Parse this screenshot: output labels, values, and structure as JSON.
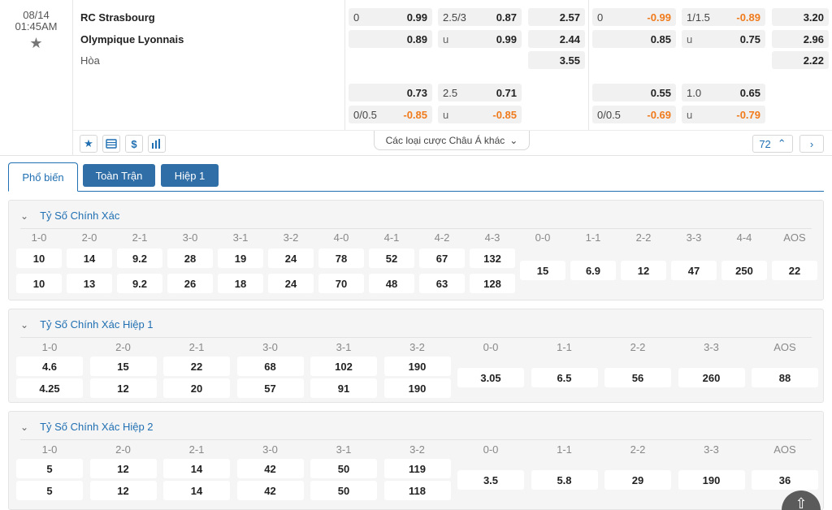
{
  "match": {
    "date": "08/14",
    "time": "01:45AM",
    "home": "RC Strasbourg",
    "away": "Olympique Lyonnais",
    "draw": "Hòa"
  },
  "odds": {
    "ft": {
      "row1": {
        "hcap": "0",
        "hcap_odd": "0.99",
        "ou": "2.5/3",
        "ou_odd": "0.87",
        "x12": "2.57"
      },
      "row2": {
        "hcap_odd": "0.89",
        "ou_lbl": "u",
        "ou_odd": "0.99",
        "x12": "2.44"
      },
      "row3": {
        "x12": "3.55"
      },
      "row4": {
        "hcap_odd": "0.73",
        "ou": "2.5",
        "ou_odd": "0.71"
      },
      "row5": {
        "hcap": "0/0.5",
        "hcap_odd": "-0.85",
        "ou_lbl": "u",
        "ou_odd": "-0.85"
      }
    },
    "h1": {
      "row1": {
        "hcap": "0",
        "hcap_odd": "-0.99",
        "ou": "1/1.5",
        "ou_odd": "-0.89",
        "x12": "3.20"
      },
      "row2": {
        "hcap_odd": "0.85",
        "ou_lbl": "u",
        "ou_odd": "0.75",
        "x12": "2.96"
      },
      "row3": {
        "x12": "2.22"
      },
      "row4": {
        "hcap_odd": "0.55",
        "ou": "1.0",
        "ou_odd": "0.65"
      },
      "row5": {
        "hcap": "0/0.5",
        "hcap_odd": "-0.69",
        "ou_lbl": "u",
        "ou_odd": "-0.79"
      }
    }
  },
  "toolbar": {
    "more_label": "Các loại cược Châu Á khác",
    "count": "72"
  },
  "tabs": [
    "Phổ biến",
    "Toàn Trận",
    "Hiệp 1"
  ],
  "sections": [
    {
      "title": "Tỷ Số Chính Xác",
      "labels": [
        "1-0",
        "2-0",
        "2-1",
        "3-0",
        "3-1",
        "3-2",
        "4-0",
        "4-1",
        "4-2",
        "4-3",
        "0-0",
        "1-1",
        "2-2",
        "3-3",
        "4-4",
        "AOS"
      ],
      "home": [
        "10",
        "14",
        "9.2",
        "28",
        "19",
        "24",
        "78",
        "52",
        "67",
        "132"
      ],
      "away": [
        "10",
        "13",
        "9.2",
        "26",
        "18",
        "24",
        "70",
        "48",
        "63",
        "128"
      ],
      "draws": [
        "15",
        "6.9",
        "12",
        "47",
        "250",
        "22"
      ]
    },
    {
      "title": "Tỷ Số Chính Xác Hiệp 1",
      "labels": [
        "1-0",
        "2-0",
        "2-1",
        "3-0",
        "3-1",
        "3-2",
        "0-0",
        "1-1",
        "2-2",
        "3-3",
        "AOS"
      ],
      "home": [
        "4.6",
        "15",
        "22",
        "68",
        "102",
        "190"
      ],
      "away": [
        "4.25",
        "12",
        "20",
        "57",
        "91",
        "190"
      ],
      "draws": [
        "3.05",
        "6.5",
        "56",
        "260",
        "88"
      ]
    },
    {
      "title": "Tỷ Số Chính Xác Hiệp 2",
      "labels": [
        "1-0",
        "2-0",
        "2-1",
        "3-0",
        "3-1",
        "3-2",
        "0-0",
        "1-1",
        "2-2",
        "3-3",
        "AOS"
      ],
      "home": [
        "5",
        "12",
        "14",
        "42",
        "50",
        "119"
      ],
      "away": [
        "5",
        "12",
        "14",
        "42",
        "50",
        "118"
      ],
      "draws": [
        "3.5",
        "5.8",
        "29",
        "190",
        "36"
      ]
    }
  ]
}
